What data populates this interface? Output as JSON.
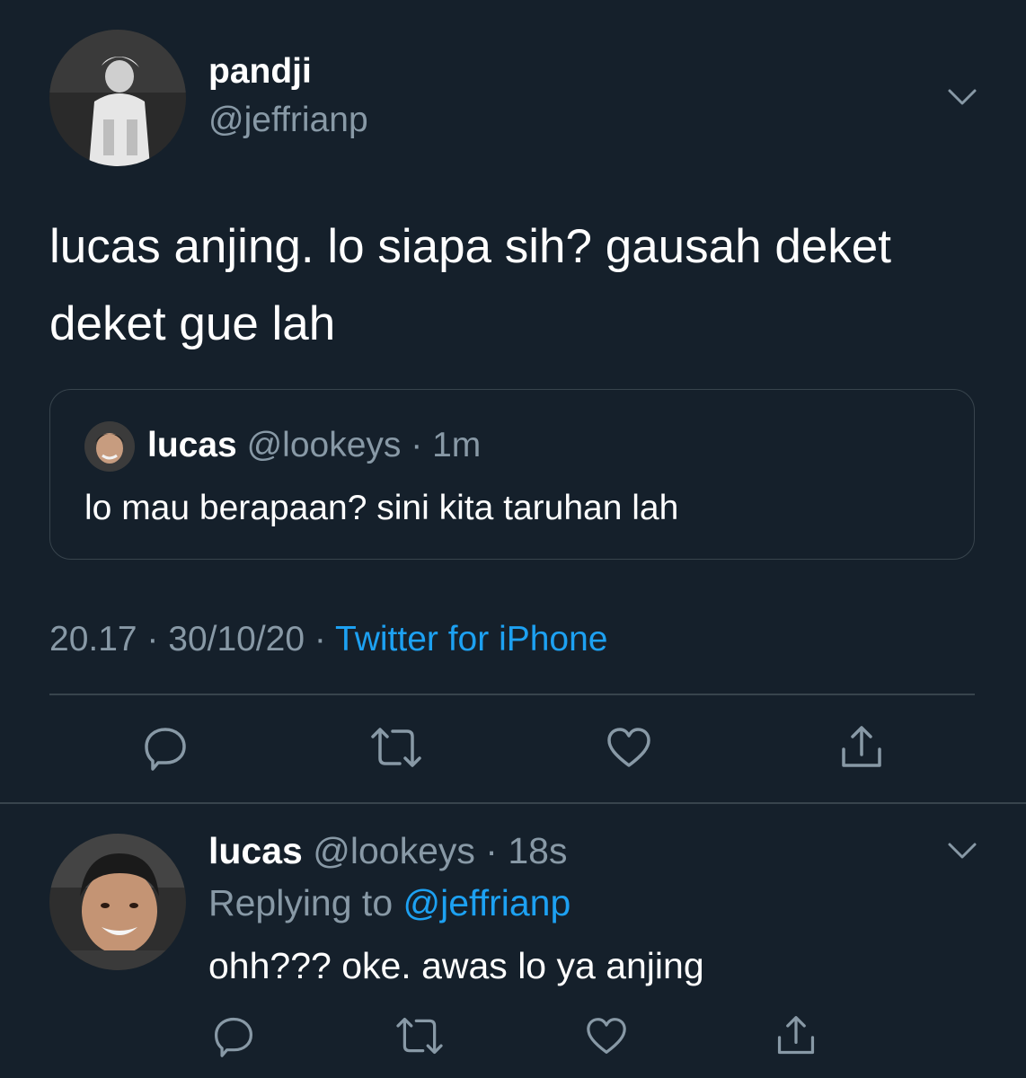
{
  "main_tweet": {
    "author_name": "pandji",
    "author_handle": "@jeffrianp",
    "text": "lucas anjing. lo siapa sih? gausah deket deket gue lah",
    "timestamp": "20.17 · 30/10/20 · ",
    "source": "Twitter for iPhone",
    "icons": [
      "reply-icon",
      "retweet-icon",
      "like-icon",
      "share-icon",
      "chevron-down-icon"
    ]
  },
  "quoted_tweet": {
    "author_name": "lucas",
    "author_handle": "@lookeys",
    "time": "· 1m",
    "text": "lo mau berapaan? sini kita taruhan lah"
  },
  "reply_tweet": {
    "author_name": "lucas",
    "author_handle": "@lookeys",
    "time": "· 18s",
    "replying_to_label": "Replying to ",
    "replying_to_handle": "@jeffrianp",
    "text": "ohh??? oke. awas lo ya anjing"
  },
  "colors": {
    "background": "#15202b",
    "text": "#ffffff",
    "secondary_text": "#8899a6",
    "accent": "#1da1f2",
    "border": "#38444d"
  }
}
